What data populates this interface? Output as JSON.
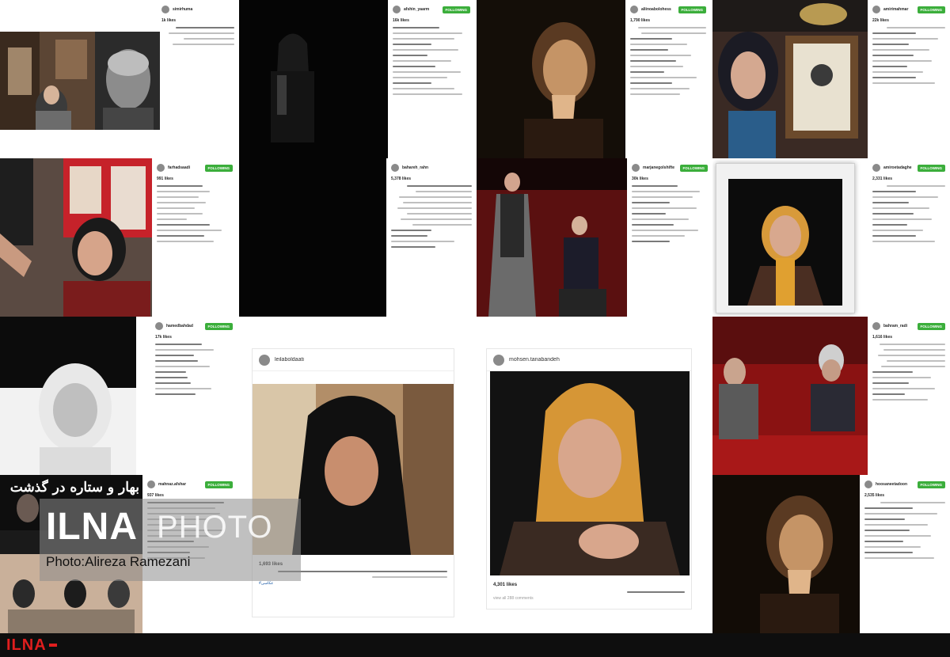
{
  "tiles": {
    "t1": {
      "username": "simirhuma",
      "likes": "1k likes"
    },
    "t2": {
      "username": "afshin_yaarm",
      "follow": "FOLLOWING",
      "likes": "16k likes"
    },
    "t3": {
      "username": "aliinoabolohess",
      "follow": "FOLLOWING",
      "likes": "1,790 likes"
    },
    "t4": {
      "username": "amirimahmar",
      "follow": "FOLLOWING",
      "likes": "22k likes"
    },
    "t5": {
      "username": "farhadsaadi",
      "follow": "FOLLOWING",
      "likes": "991 likes"
    },
    "t6": {
      "username": "bahareh_rahn",
      "likes": "5,378 likes"
    },
    "t7": {
      "username": "marjanegolshifte",
      "follow": "FOLLOWING",
      "likes": "30k likes"
    },
    "t8": {
      "username": "amiroetadaghe",
      "follow": "FOLLOWING",
      "likes": "2,331 likes"
    },
    "t9": {
      "username": "hamedbahdad",
      "follow": "FOLLOWING",
      "likes": "17k likes"
    },
    "t10": {
      "username": "mohsen.tanabandeh",
      "likes": "4,301 likes",
      "comments": "view all 288 comments"
    },
    "t11": {
      "username": "leilaboldaati",
      "likes": "1,693 likes",
      "hashtag": "#عکاسی"
    },
    "t12": {
      "username": "bahram_radi",
      "follow": "FOLLOWING",
      "likes": "1,616 likes"
    },
    "t13": {
      "username": "hoosaneetadoon",
      "follow": "FOLLOWING",
      "likes": "2,535 likes"
    },
    "t14": {
      "username": "mahnaz.afshar",
      "follow": "FOLLOWING",
      "likes": "937 likes"
    }
  },
  "banner": {
    "line1": "بهار و ستاره در گذشت"
  },
  "watermark": {
    "brand": "ILNA",
    "photo": "PHOTO",
    "credit": "Photo:Alireza Ramezani"
  },
  "footer": {
    "logo": "ILNA"
  },
  "colors": {
    "follow_green": "#3bae3b",
    "brand_red": "#e01e1e",
    "footer_bg": "#0e0e0e"
  }
}
